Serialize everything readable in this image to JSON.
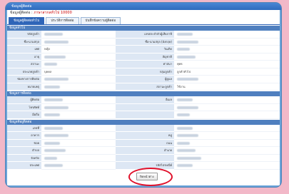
{
  "window": {
    "title": "ข้อมูลผู้ติดต่อ",
    "subtitle_prefix": "ข้อมูลผู้ติดต่อ : ",
    "subtitle_value": "ภาษาสากลทั่วไป 10000"
  },
  "tabs": [
    {
      "label": "ข้อมูลผู้ติดต่อทั่วไป"
    },
    {
      "label": "ประวัติการติดต่อ"
    },
    {
      "label": "บันทึกข้อความผู้ติดต่อ"
    }
  ],
  "sections": {
    "general": "ข้อมูลทั่วไป",
    "contact": "ข้อมูลการติดต่อ",
    "address": "ข้อมูลที่อยู่ติดต่อ"
  },
  "general_rows": [
    {
      "l1": "รหัสลูกค้า",
      "v1": "",
      "l2": "เลขประจำตัวผู้เสียภาษี",
      "v2": ""
    },
    {
      "l1": "ชื่อ-นามสกุล",
      "v1": "",
      "l2": "ชื่อ-นามสกุล (อังกฤษ)",
      "v2": ""
    },
    {
      "l1": "เพศ",
      "v1": "หญิง",
      "l2": "วันเกิด",
      "v2": ""
    },
    {
      "l1": "อายุ",
      "v1": "",
      "l2": "สัญชาติ",
      "v2": ""
    },
    {
      "l1": "สถานะ",
      "v1": "",
      "l2": "ศาสนา",
      "v2": "พุทธ"
    },
    {
      "l1": "ประเภทลูกค้า",
      "v1": "บุคคล",
      "l2": "กลุ่มลูกค้า",
      "v2": "ลูกค้าทั่วไป"
    },
    {
      "l1": "ช่องทางการติดต่อ",
      "v1": "",
      "l2": "ผู้ดูแล",
      "v2": ""
    },
    {
      "l1": "หมายเหตุ",
      "v1": "",
      "l2": "สถานะลูกค้า",
      "v2": "ใช้งาน"
    }
  ],
  "contact_rows": [
    {
      "l1": "ผู้ติดต่อ",
      "v1": "",
      "l2": "อีเมล",
      "v2": ""
    },
    {
      "l1": "โทรศัพท์",
      "v1": "",
      "l2": "",
      "v2": ""
    },
    {
      "l1": "มือถือ",
      "v1": "",
      "l2": "",
      "v2": ""
    }
  ],
  "address_rows": [
    {
      "l1": "เลขที่",
      "v1": "",
      "l2": "",
      "v2": ""
    },
    {
      "l1": "อาคาร",
      "v1": "",
      "l2": "หมู่",
      "v2": ""
    },
    {
      "l1": "ซอย",
      "v1": "",
      "l2": "ถนน",
      "v2": ""
    },
    {
      "l1": "ตำบล",
      "v1": "",
      "l2": "อำเภอ",
      "v2": ""
    },
    {
      "l1": "จังหวัด",
      "v1": "",
      "l2": "",
      "v2": ""
    },
    {
      "l1": "ประเทศ",
      "v1": "",
      "l2": "รหัสไปรษณีย์",
      "v2": ""
    }
  ],
  "footer": {
    "close_label": "ปิดหน้าต่าง"
  },
  "colors": {
    "accent": "#2f65b8",
    "highlight_ring": "#e0102a",
    "background": "#f2b8c8"
  }
}
